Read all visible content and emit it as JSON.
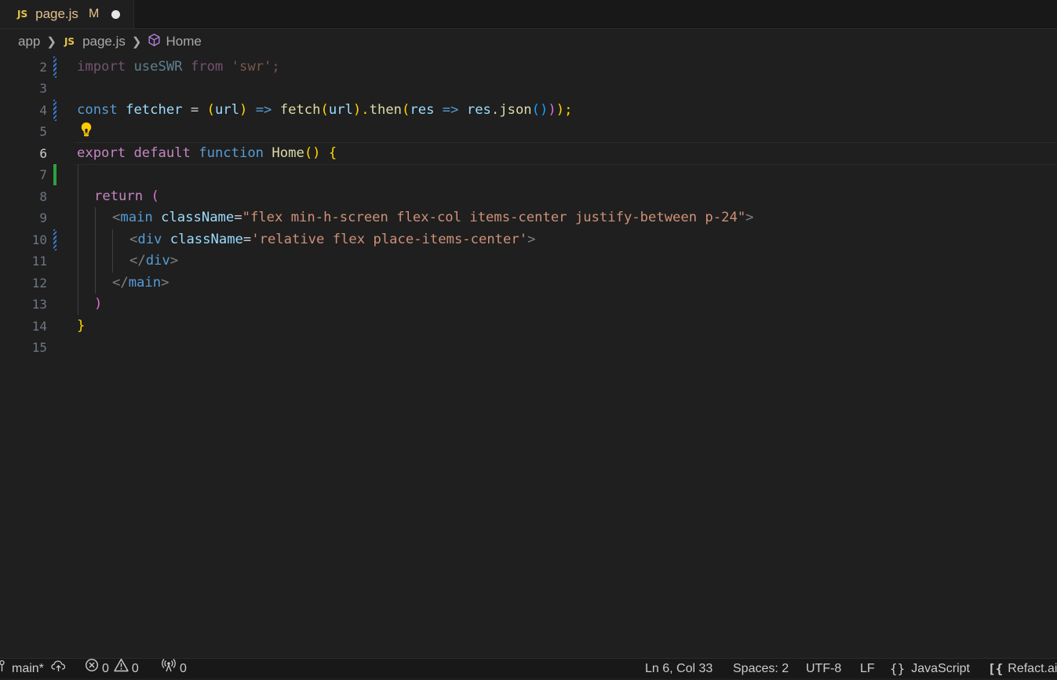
{
  "tab": {
    "file_label": "JS",
    "file_name": "page.js",
    "status": "M"
  },
  "breadcrumb": {
    "folder": "app",
    "file_label": "JS",
    "file": "page.js",
    "symbol": "Home"
  },
  "editor": {
    "line_numbers": [
      "2",
      "3",
      "4",
      "5",
      "6",
      "7",
      "8",
      "9",
      "10",
      "11",
      "12",
      "13",
      "14",
      "15"
    ],
    "active_line": "6"
  },
  "code": {
    "l2": {
      "t1": "import",
      "t2": " useSWR ",
      "t3": "from",
      "t4": " 'swr';"
    },
    "l4": {
      "t1": "const",
      "t2": " fetcher",
      "t3": " = ",
      "t4": "(",
      "t5": "url",
      "t6": ")",
      "t7": " => ",
      "t8": "fetch",
      "t9": "(",
      "t10": "url",
      "t11": ").",
      "t12": "then",
      "t13": "(",
      "t14": "res",
      "t15": " => ",
      "t16": "res",
      "t17": ".",
      "t18": "json",
      "t19": "()",
      "t20": ")",
      "t21": ");"
    },
    "l6": {
      "t1": "export",
      "t2": " ",
      "t3": "default",
      "t4": " ",
      "t5": "function",
      "t6": " ",
      "t7": "Home",
      "t8": "()",
      "t9": " ",
      "t10": "{"
    },
    "l8": {
      "t1": "return",
      "t2": " ("
    },
    "l9": {
      "t1": "<",
      "t2": "main",
      "t3": " className",
      "t4": "=",
      "t5": "\"flex min-h-screen flex-col items-center justify-between p-24\"",
      "t6": ">"
    },
    "l10": {
      "t1": "<",
      "t2": "div",
      "t3": " className",
      "t4": "=",
      "t5": "'relative flex place-items-center'",
      "t6": ">"
    },
    "l11": {
      "t1": "</",
      "t2": "div",
      "t3": ">"
    },
    "l12": {
      "t1": "</",
      "t2": "main",
      "t3": ">"
    },
    "l13": {
      "t1": ")"
    },
    "l14": {
      "t1": "}"
    }
  },
  "status": {
    "branch": "main*",
    "errors": "0",
    "warnings": "0",
    "ports": "0",
    "position": "Ln 6, Col 33",
    "spaces": "Spaces: 2",
    "encoding": "UTF-8",
    "eol": "LF",
    "language": "JavaScript",
    "extension": "Refact.ai"
  },
  "colors": {
    "background": "#1f1f1f",
    "keyword": "#c586c0",
    "string": "#ce9178",
    "variable": "#9cdcfe",
    "function": "#dcdcaa",
    "storage": "#569cd6",
    "bracket_gold": "#ffd700"
  }
}
